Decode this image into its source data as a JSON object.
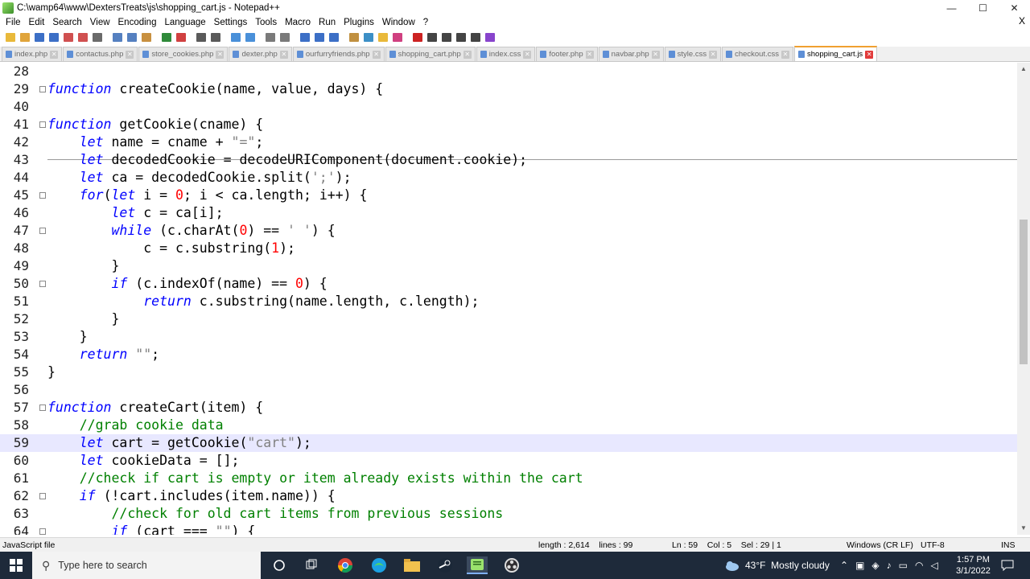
{
  "window": {
    "title": "C:\\wamp64\\www\\DextersTreats\\js\\shopping_cart.js - Notepad++",
    "controls": {
      "minimize": "—",
      "maximize": "☐",
      "close": "✕"
    }
  },
  "menu": [
    "File",
    "Edit",
    "Search",
    "View",
    "Encoding",
    "Language",
    "Settings",
    "Tools",
    "Macro",
    "Run",
    "Plugins",
    "Window",
    "?"
  ],
  "menu_close": "X",
  "toolbar": {
    "icons": [
      "new-file-icon",
      "open-file-icon",
      "save-icon",
      "save-all-icon",
      "close-icon",
      "close-all-icon",
      "print-icon",
      "cut-icon",
      "copy-icon",
      "paste-icon",
      "undo-icon",
      "redo-icon",
      "find-icon",
      "replace-icon",
      "zoom-in-icon",
      "zoom-out-icon",
      "sync-v-icon",
      "sync-h-icon",
      "wrap-icon",
      "all-chars-icon",
      "indent-guide-icon",
      "doc-map-icon",
      "function-list-icon",
      "folder-workspace-icon",
      "monitor-icon",
      "record-macro-icon",
      "stop-macro-icon",
      "play-macro-icon",
      "run-macro-icon",
      "save-macro-icon",
      "spellcheck-icon"
    ],
    "colors": [
      "#e9b93a",
      "#e0a43b",
      "#3c6fc6",
      "#3c6fc6",
      "#d05050",
      "#d05050",
      "#6a6a6a",
      "#5580c0",
      "#5580c0",
      "#c89040",
      "#2f8a3a",
      "#d04040",
      "#5a5a5a",
      "#5a5a5a",
      "#4a90d9",
      "#4a90d9",
      "#7a7a7a",
      "#7a7a7a",
      "#3c6fc6",
      "#3c6fc6",
      "#3c6fc6",
      "#c09040",
      "#3c8fc6",
      "#e9b93a",
      "#d04080",
      "#cc2222",
      "#444",
      "#444",
      "#444",
      "#444",
      "#8844cc"
    ]
  },
  "tabs": [
    {
      "label": "index.php",
      "active": false
    },
    {
      "label": "contactus.php",
      "active": false
    },
    {
      "label": "store_cookies.php",
      "active": false
    },
    {
      "label": "dexter.php",
      "active": false
    },
    {
      "label": "ourfurryfriends.php",
      "active": false
    },
    {
      "label": "shopping_cart.php",
      "active": false
    },
    {
      "label": "index.css",
      "active": false
    },
    {
      "label": "footer.php",
      "active": false
    },
    {
      "label": "navbar.php",
      "active": false
    },
    {
      "label": "style.css",
      "active": false
    },
    {
      "label": "checkout.css",
      "active": false
    },
    {
      "label": "shopping_cart.js",
      "active": true
    }
  ],
  "tab_close_glyph": "✕",
  "editor": {
    "lines": [
      {
        "n": "28",
        "fold": "",
        "tokens": []
      },
      {
        "n": "29",
        "fold": "⊞",
        "tokens": [
          [
            "kw",
            "function "
          ],
          [
            "fn",
            "createCookie(name, value, days) {"
          ]
        ]
      },
      {
        "n": "40",
        "fold": "",
        "tokens": []
      },
      {
        "n": "41",
        "fold": "⊟",
        "tokens": [
          [
            "kw",
            "function "
          ],
          [
            "fn",
            "getCookie(cname) {"
          ]
        ]
      },
      {
        "n": "42",
        "fold": "",
        "tokens": [
          [
            "fn",
            "    "
          ],
          [
            "kw",
            "let "
          ],
          [
            "fn",
            "name = cname + "
          ],
          [
            "str",
            "\"=\""
          ],
          [
            "fn",
            ";"
          ]
        ]
      },
      {
        "n": "43",
        "fold": "",
        "tokens": [
          [
            "fn",
            "    "
          ],
          [
            "kw",
            "let "
          ],
          [
            "fn",
            "decodedCookie = decodeURIComponent(document.cookie);"
          ]
        ]
      },
      {
        "n": "44",
        "fold": "",
        "tokens": [
          [
            "fn",
            "    "
          ],
          [
            "kw",
            "let "
          ],
          [
            "fn",
            "ca = decodedCookie.split("
          ],
          [
            "str",
            "';'"
          ],
          [
            "fn",
            ");"
          ]
        ]
      },
      {
        "n": "45",
        "fold": "⊟",
        "tokens": [
          [
            "fn",
            "    "
          ],
          [
            "kw",
            "for"
          ],
          [
            "fn",
            "("
          ],
          [
            "kw",
            "let "
          ],
          [
            "fn",
            "i = "
          ],
          [
            "num",
            "0"
          ],
          [
            "fn",
            "; i < ca.length; i++) {"
          ]
        ]
      },
      {
        "n": "46",
        "fold": "",
        "tokens": [
          [
            "fn",
            "        "
          ],
          [
            "kw",
            "let "
          ],
          [
            "fn",
            "c = ca[i];"
          ]
        ]
      },
      {
        "n": "47",
        "fold": "⊟",
        "tokens": [
          [
            "fn",
            "        "
          ],
          [
            "kw",
            "while "
          ],
          [
            "fn",
            "(c.charAt("
          ],
          [
            "num",
            "0"
          ],
          [
            "fn",
            ") == "
          ],
          [
            "str",
            "' '"
          ],
          [
            "fn",
            ") {"
          ]
        ]
      },
      {
        "n": "48",
        "fold": "",
        "tokens": [
          [
            "fn",
            "            c = c.substring("
          ],
          [
            "num",
            "1"
          ],
          [
            "fn",
            ");"
          ]
        ]
      },
      {
        "n": "49",
        "fold": "",
        "tokens": [
          [
            "fn",
            "        }"
          ]
        ]
      },
      {
        "n": "50",
        "fold": "⊟",
        "tokens": [
          [
            "fn",
            "        "
          ],
          [
            "kw",
            "if "
          ],
          [
            "fn",
            "(c.indexOf(name) == "
          ],
          [
            "num",
            "0"
          ],
          [
            "fn",
            ") {"
          ]
        ]
      },
      {
        "n": "51",
        "fold": "",
        "tokens": [
          [
            "fn",
            "            "
          ],
          [
            "kw",
            "return "
          ],
          [
            "fn",
            "c.substring(name.length, c.length);"
          ]
        ]
      },
      {
        "n": "52",
        "fold": "",
        "tokens": [
          [
            "fn",
            "        }"
          ]
        ]
      },
      {
        "n": "53",
        "fold": "",
        "tokens": [
          [
            "fn",
            "    }"
          ]
        ]
      },
      {
        "n": "54",
        "fold": "",
        "tokens": [
          [
            "fn",
            "    "
          ],
          [
            "kw",
            "return "
          ],
          [
            "str",
            "\"\""
          ],
          [
            "fn",
            ";"
          ]
        ]
      },
      {
        "n": "55",
        "fold": "",
        "tokens": [
          [
            "fn",
            "}"
          ]
        ]
      },
      {
        "n": "56",
        "fold": "",
        "tokens": []
      },
      {
        "n": "57",
        "fold": "⊟",
        "tokens": [
          [
            "kw",
            "function "
          ],
          [
            "fn",
            "createCart(item) {"
          ]
        ]
      },
      {
        "n": "58",
        "fold": "",
        "tokens": [
          [
            "fn",
            "    "
          ],
          [
            "cmt",
            "//grab cookie data"
          ]
        ]
      },
      {
        "n": "59",
        "fold": "",
        "current": true,
        "tokens": [
          [
            "fn",
            "    "
          ],
          [
            "kw",
            "let "
          ],
          [
            "fn",
            "cart = getCookie("
          ],
          [
            "str",
            "\"cart\""
          ],
          [
            "fn",
            ");"
          ]
        ]
      },
      {
        "n": "60",
        "fold": "",
        "tokens": [
          [
            "fn",
            "    "
          ],
          [
            "kw",
            "let "
          ],
          [
            "fn",
            "cookieData = [];"
          ]
        ]
      },
      {
        "n": "61",
        "fold": "",
        "tokens": [
          [
            "fn",
            "    "
          ],
          [
            "cmt",
            "//check if cart is empty or item already exists within the cart"
          ]
        ]
      },
      {
        "n": "62",
        "fold": "⊟",
        "tokens": [
          [
            "fn",
            "    "
          ],
          [
            "kw",
            "if "
          ],
          [
            "fn",
            "(!cart.includes(item.name)) {"
          ]
        ]
      },
      {
        "n": "63",
        "fold": "",
        "tokens": [
          [
            "fn",
            "        "
          ],
          [
            "cmt",
            "//check for old cart items from previous sessions"
          ]
        ]
      },
      {
        "n": "64",
        "fold": "⊟",
        "tokens": [
          [
            "fn",
            "        "
          ],
          [
            "kw",
            "if "
          ],
          [
            "fn",
            "(cart === "
          ],
          [
            "str",
            "\"\""
          ],
          [
            "fn",
            ") {"
          ]
        ]
      }
    ]
  },
  "status": {
    "file_type": "JavaScript file",
    "length": "length : 2,614    lines : 99",
    "position": "Ln : 59    Col : 5    Sel : 29 | 1",
    "eol": "Windows (CR LF)",
    "encoding": "UTF-8",
    "mode": "INS"
  },
  "taskbar": {
    "search_placeholder": "Type here to search",
    "weather": "43°F  Mostly cloudy",
    "time": "1:57 PM",
    "date": "3/1/2022"
  }
}
